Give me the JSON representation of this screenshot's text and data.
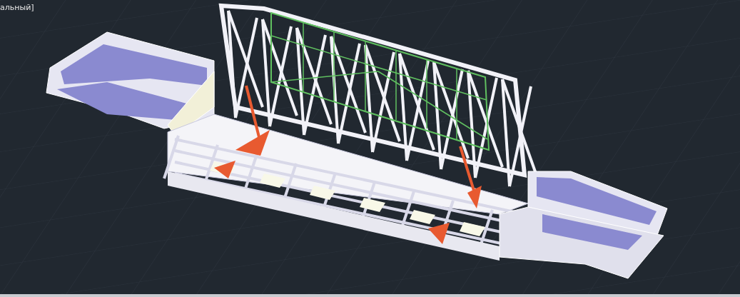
{
  "viewport": {
    "label": "альный]"
  }
}
